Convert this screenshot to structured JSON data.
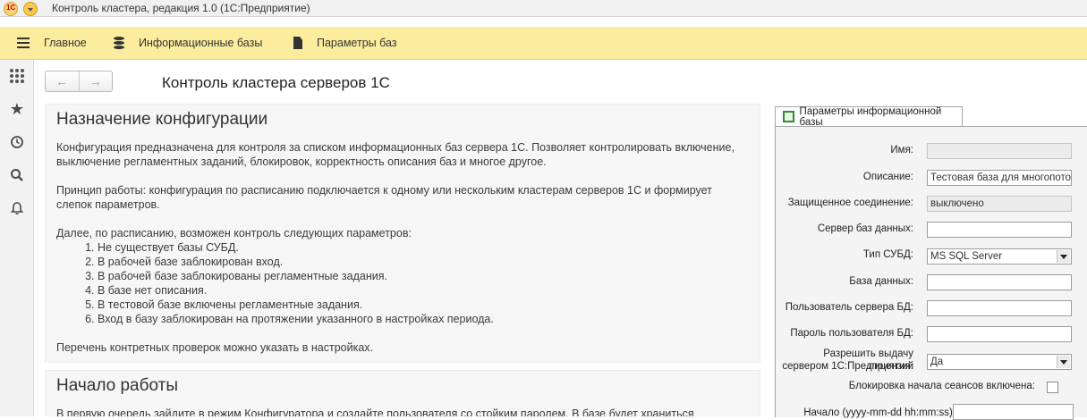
{
  "window": {
    "logo_text": "1С",
    "title": "Контроль кластера, редакция 1.0  (1С:Предприятие)"
  },
  "sections": [
    {
      "label": "Главное",
      "icon": "menu-icon"
    },
    {
      "label": "Информационные базы",
      "icon": "database-icon"
    },
    {
      "label": "Параметры баз",
      "icon": "document-icon"
    }
  ],
  "left_panel": [
    "apps-grid-icon",
    "favorites-star-icon",
    "history-icon",
    "search-icon",
    "notifications-bell-icon"
  ],
  "nav": {
    "back": "←",
    "forward": "→"
  },
  "page_title": "Контроль кластера серверов 1С",
  "purpose": {
    "heading": "Назначение конфигурации",
    "p1_line1": "Конфигурация предназначена для контроля за списком информационных баз сервера 1С. Позволяет контролировать включение,",
    "p1_line2": "выключение регламентных заданий, блокировок, корректность описания баз и многое другое.",
    "p2_line1": "Принцип работы: конфигурация по расписанию подключается к одному или нескольким кластерам серверов 1С и формирует",
    "p2_line2": "слепок параметров.",
    "p3": "Далее, по расписанию, возможен контроль следующих параметров:",
    "list": [
      "Не существует базы СУБД.",
      "В рабочей базе заблокирован вход.",
      "В рабочей базе заблокированы регламентные задания.",
      "В базе нет описания.",
      "В тестовой базе включены регламентные задания.",
      "Вход в базу заблокирован на протяжении указанного в настройках периода."
    ],
    "p4": "Перечень контретных проверок можно указать в настройках."
  },
  "start": {
    "heading": "Начало работы",
    "p1": "В первую очередь зайдите в режим Конфигуратора и создайте пользователя со стойким паролем. В базе будет храниться"
  },
  "params": {
    "tab_label": "Параметры информационной базы",
    "name_label": "Имя:",
    "name_value": "",
    "description_label": "Описание:",
    "description_value": "Тестовая база для многопоточ",
    "secure_label": "Защищенное соединение:",
    "secure_value": "выключено",
    "db_server_label": "Сервер баз данных:",
    "db_server_value": "",
    "dbms_type_label": "Тип СУБД:",
    "dbms_type_value": "MS SQL Server",
    "database_label": "База данных:",
    "database_value": "",
    "db_user_label": "Пользователь сервера БД:",
    "db_user_value": "",
    "db_password_label": "Пароль пользователя БД:",
    "db_password_value": "",
    "license_label_line1": "Разрешить выдачу лицензий",
    "license_label_line2": "сервером 1С:Предприятия:",
    "license_value": "Да",
    "session_lock_label": "Блокировка начала сеансов включена:",
    "session_lock_checked": false,
    "start_label": "Начало (yyyy-mm-dd hh:mm:ss):",
    "start_value": ""
  }
}
